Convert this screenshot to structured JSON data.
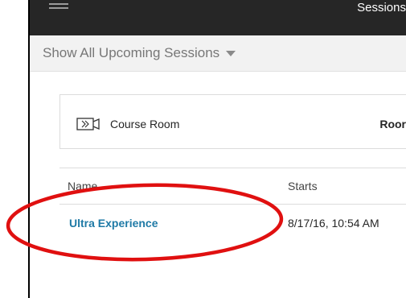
{
  "header": {
    "title": "Sessions",
    "menu_icon": "hamburger-menu-icon"
  },
  "filter": {
    "label": "Show All Upcoming Sessions",
    "icon": "caret-down-icon"
  },
  "course_room": {
    "icon": "video-camera-icon",
    "name": "Course Room",
    "link_label": "Roor"
  },
  "sessions_table": {
    "columns": [
      "Name",
      "Starts"
    ],
    "rows": [
      {
        "name": "Ultra Experience",
        "starts": "8/17/16, 10:54 AM"
      }
    ]
  },
  "annotation": {
    "color": "#e01010",
    "shape": "ellipse"
  }
}
